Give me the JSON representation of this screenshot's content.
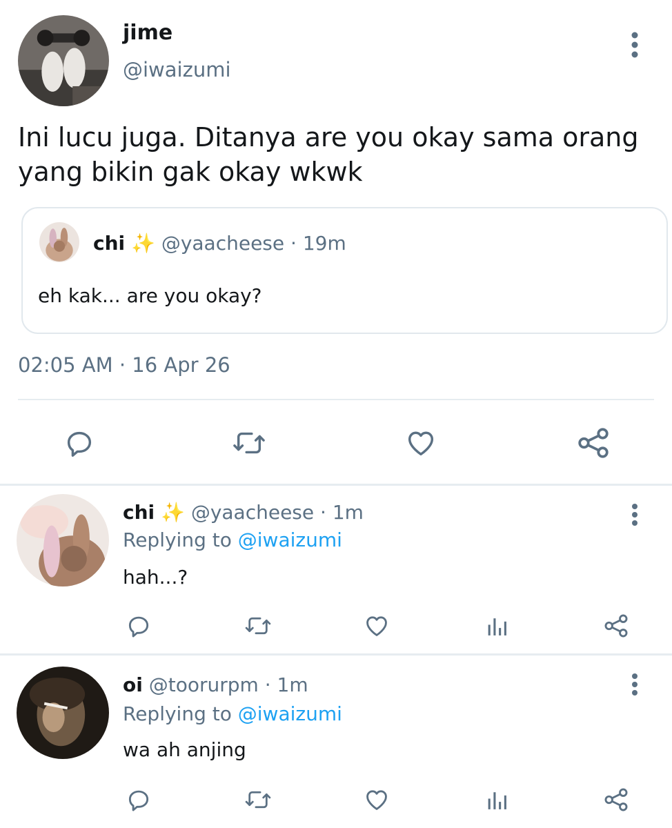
{
  "main_tweet": {
    "name": "jime",
    "handle": "@iwaizumi",
    "text": "Ini lucu juga. Ditanya are you okay sama orang yang bikin gak okay wkwk",
    "quote": {
      "name": "chi",
      "emoji": "✨",
      "handle": "@yaacheese",
      "time_ago": "· 19m",
      "text": "eh kak... are you okay?"
    },
    "timestamp": "02:05 AM · 16 Apr 26"
  },
  "replies": [
    {
      "name": "chi",
      "emoji": "✨",
      "handle": "@yaacheese",
      "time_ago": "· 1m",
      "replying_prefix": "Replying to",
      "replying_to": "@iwaizumi",
      "text": "hah...?"
    },
    {
      "name": "oi",
      "handle": "@toorurpm",
      "time_ago": "· 1m",
      "replying_prefix": "Replying to",
      "replying_to": "@iwaizumi",
      "text": "wa ah anjing"
    }
  ],
  "icons": {
    "reply": "reply-icon",
    "retweet": "retweet-icon",
    "like": "heart-icon",
    "analytics": "analytics-icon",
    "share": "share-icon",
    "more": "more-vertical-icon"
  },
  "colors": {
    "text": "#14171a",
    "muted": "#5b7083",
    "link": "#1da1f2",
    "divider": "#e6ecf0"
  }
}
